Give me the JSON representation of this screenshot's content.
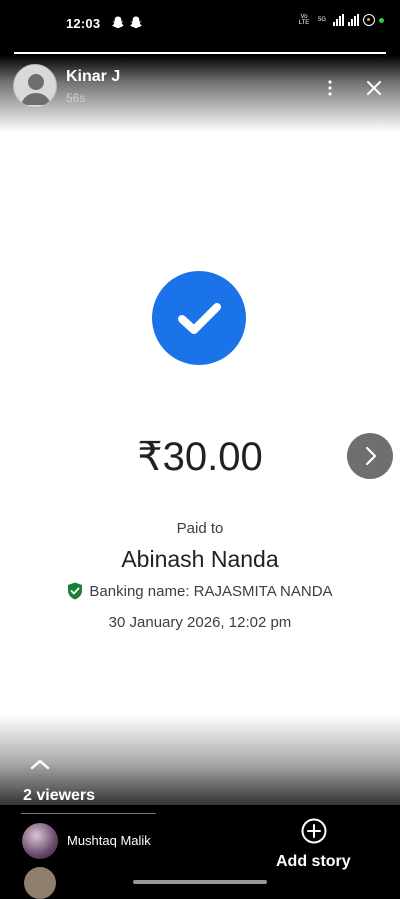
{
  "status_bar": {
    "time": "12:03",
    "volte_label": "Vo LTE",
    "network_label": "5G",
    "icons": [
      "snapchat-icon",
      "snapchat-icon",
      "signal-icon",
      "signal-icon",
      "battery-icon",
      "green-dot-indicator"
    ]
  },
  "story": {
    "user_name": "Kinar J",
    "time_ago": "56s",
    "amount": "₹30.00",
    "paid_to_label": "Paid to",
    "payee_name": "Abinash Nanda",
    "banking_name": "Banking name: RAJASMITA NANDA",
    "datetime": "30 January 2026, 12:02 pm",
    "viewers_label": "2 viewers",
    "check_color": "#1a73e8",
    "shield_color": "#188038"
  },
  "viewers_list": [
    {
      "name": "Mushtaq Malik"
    }
  ],
  "actions": {
    "add_story_label": "Add story"
  }
}
